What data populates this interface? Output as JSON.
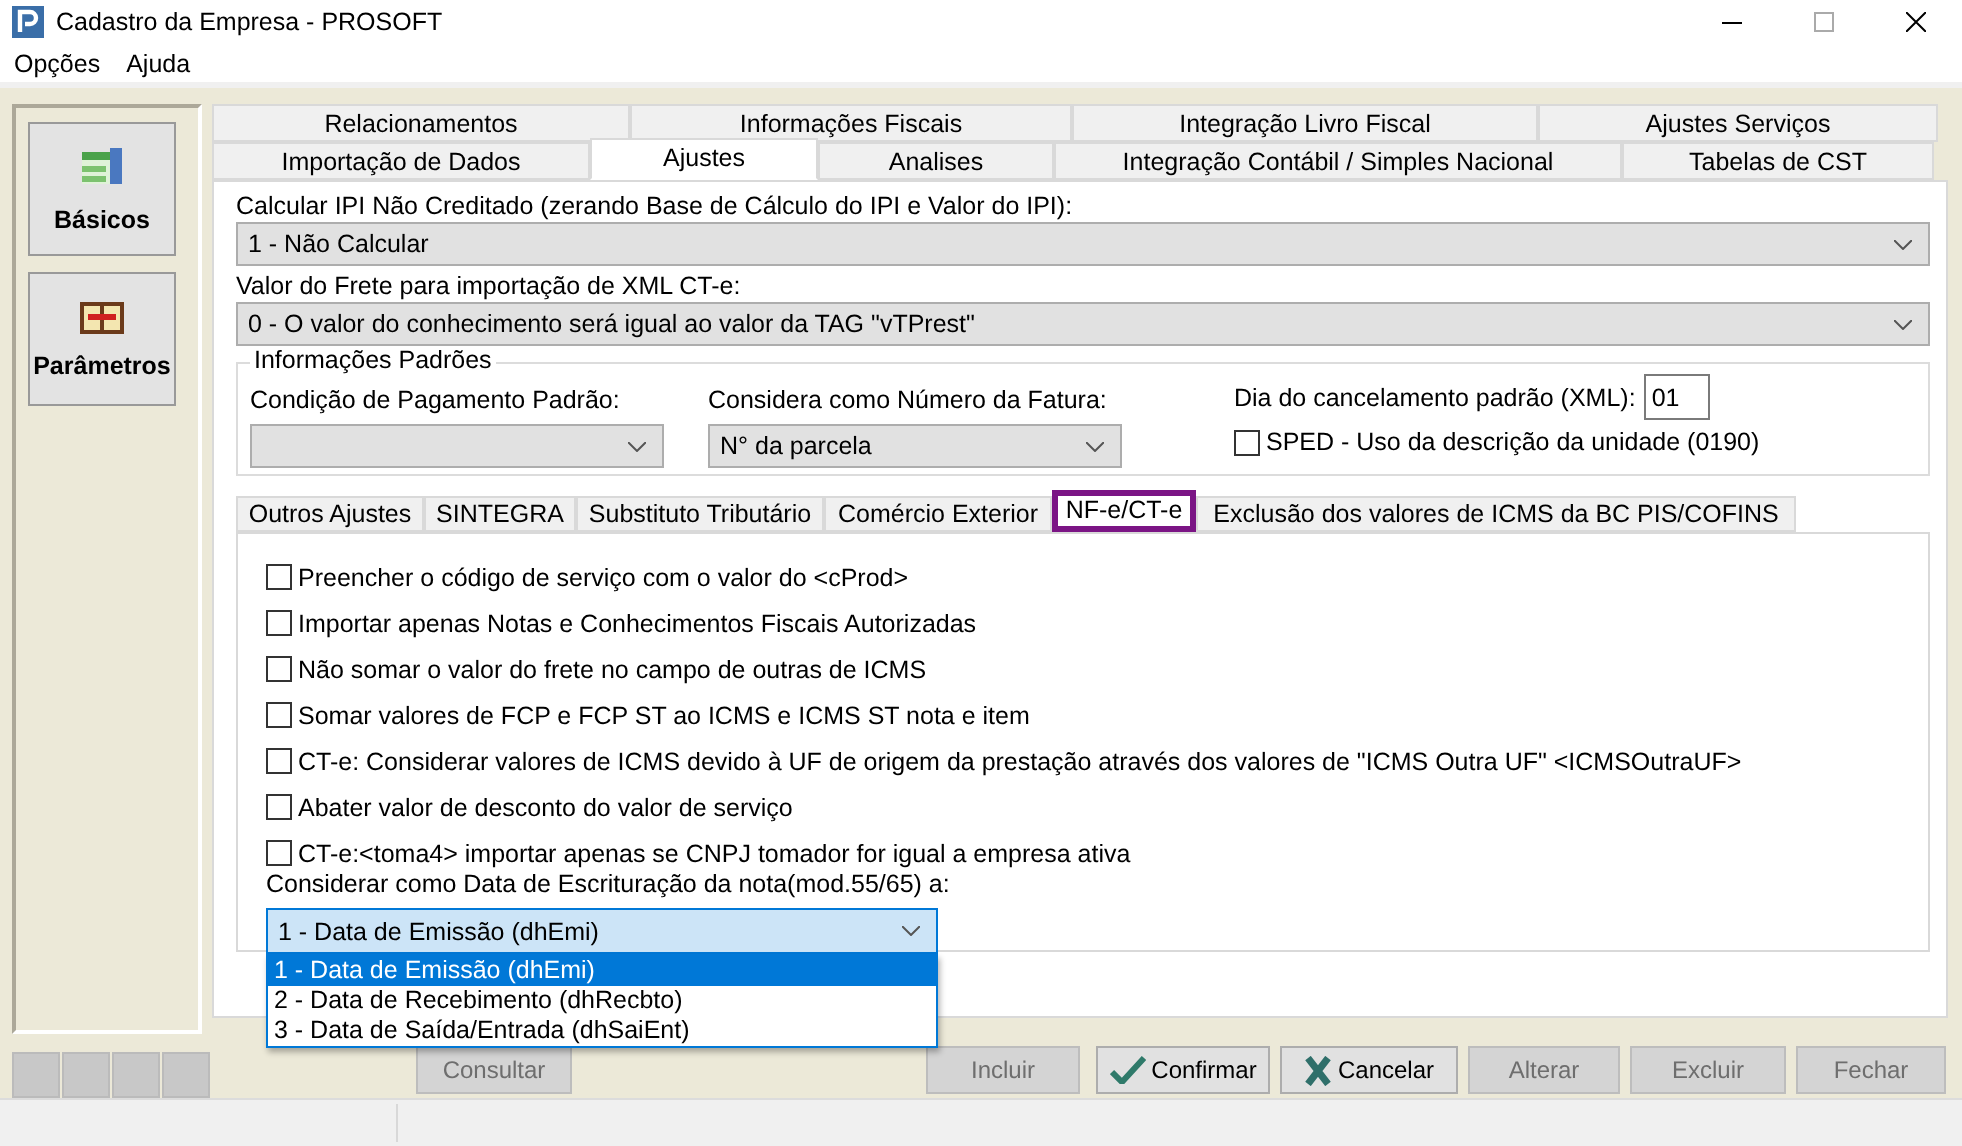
{
  "window": {
    "title": "Cadastro da Empresa - PROSOFT"
  },
  "menu": [
    "Opções",
    "Ajuda"
  ],
  "sidebar": {
    "items": [
      {
        "label": "Básicos",
        "kind": "basicos"
      },
      {
        "label": "Parâmetros",
        "kind": "parametros"
      }
    ]
  },
  "tab_rows": [
    {
      "tabs": [
        {
          "label": "Relacionamentos",
          "selected": false
        },
        {
          "label": "Informações Fiscais",
          "selected": false
        },
        {
          "label": "Integração Livro Fiscal",
          "selected": false
        },
        {
          "label": "Ajustes Serviços",
          "selected": false
        }
      ]
    },
    {
      "tabs": [
        {
          "label": "Importação de Dados",
          "selected": false
        },
        {
          "label": "Ajustes",
          "selected": true
        },
        {
          "label": "Analises",
          "selected": false
        },
        {
          "label": "Integração Contábil / Simples Nacional",
          "selected": false
        },
        {
          "label": "Tabelas de CST",
          "selected": false
        }
      ]
    }
  ],
  "ipi": {
    "label": "Calcular IPI Não Creditado (zerando Base de Cálculo do IPI e Valor do IPI):",
    "value": "1 - Não Calcular"
  },
  "frete": {
    "label": "Valor do Frete para importação de XML CT-e:",
    "value": "0 - O valor do conhecimento será igual ao valor da TAG \"vTPrest\""
  },
  "informacoes_padroes": {
    "title": "Informações Padrões",
    "condicao": {
      "label": "Condição de Pagamento Padrão:"
    },
    "numero_fatura": {
      "label": "Considera como Número da Fatura:",
      "value": "N° da parcela"
    },
    "dia_cancelamento": {
      "label": "Dia do cancelamento padrão (XML):",
      "value": "01"
    },
    "sped": {
      "label": "SPED - Uso da descrição da unidade (0190)",
      "checked": false
    }
  },
  "subtabs": [
    {
      "label": "Outros Ajustes",
      "selected": false
    },
    {
      "label": "SINTEGRA",
      "selected": false
    },
    {
      "label": "Substituto Tributário",
      "selected": false
    },
    {
      "label": "Comércio Exterior",
      "selected": false
    },
    {
      "label": "NF-e/CT-e",
      "selected": true
    },
    {
      "label": "Exclusão dos valores de ICMS da BC PIS/COFINS",
      "selected": false
    }
  ],
  "options": [
    {
      "label": "Preencher o código de serviço com o valor do <cProd>",
      "checked": false
    },
    {
      "label": "Importar apenas Notas e Conhecimentos Fiscais Autorizadas",
      "checked": false
    },
    {
      "label": "Não somar o valor do frete no campo de outras de ICMS",
      "checked": false
    },
    {
      "label": "Somar valores de FCP e FCP ST ao ICMS e ICMS ST nota e item",
      "checked": false
    },
    {
      "label": "CT-e: Considerar valores de ICMS devido à UF de origem da prestação através dos valores de \"ICMS Outra UF\" <ICMSOutraUF>",
      "checked": false
    },
    {
      "label": "Abater valor de desconto do valor de serviço",
      "checked": false
    },
    {
      "label": "CT-e:<toma4> importar apenas se CNPJ tomador for igual a empresa ativa",
      "checked": false
    }
  ],
  "escrituracao": {
    "label": "Considerar como Data de Escrituração da nota(mod.55/65) a:",
    "value": "1 -  Data de Emissão (dhEmi)",
    "expanded": true,
    "options": [
      {
        "label": "1 -  Data de Emissão (dhEmi)",
        "selected": true
      },
      {
        "label": "2 -  Data de Recebimento (dhRecbto)",
        "selected": false
      },
      {
        "label": "3 -  Data de Saída/Entrada (dhSaiEnt)",
        "selected": false
      }
    ]
  },
  "buttons": [
    {
      "label": "Consultar",
      "disabled": true,
      "kind": "plain"
    },
    {
      "label": "Incluir",
      "disabled": true,
      "kind": "plain"
    },
    {
      "label": "Confirmar",
      "disabled": false,
      "kind": "confirm"
    },
    {
      "label": "Cancelar",
      "disabled": false,
      "kind": "cancel"
    },
    {
      "label": "Alterar",
      "disabled": true,
      "kind": "plain"
    },
    {
      "label": "Excluir",
      "disabled": true,
      "kind": "plain"
    },
    {
      "label": "Fechar",
      "disabled": true,
      "kind": "plain"
    }
  ]
}
